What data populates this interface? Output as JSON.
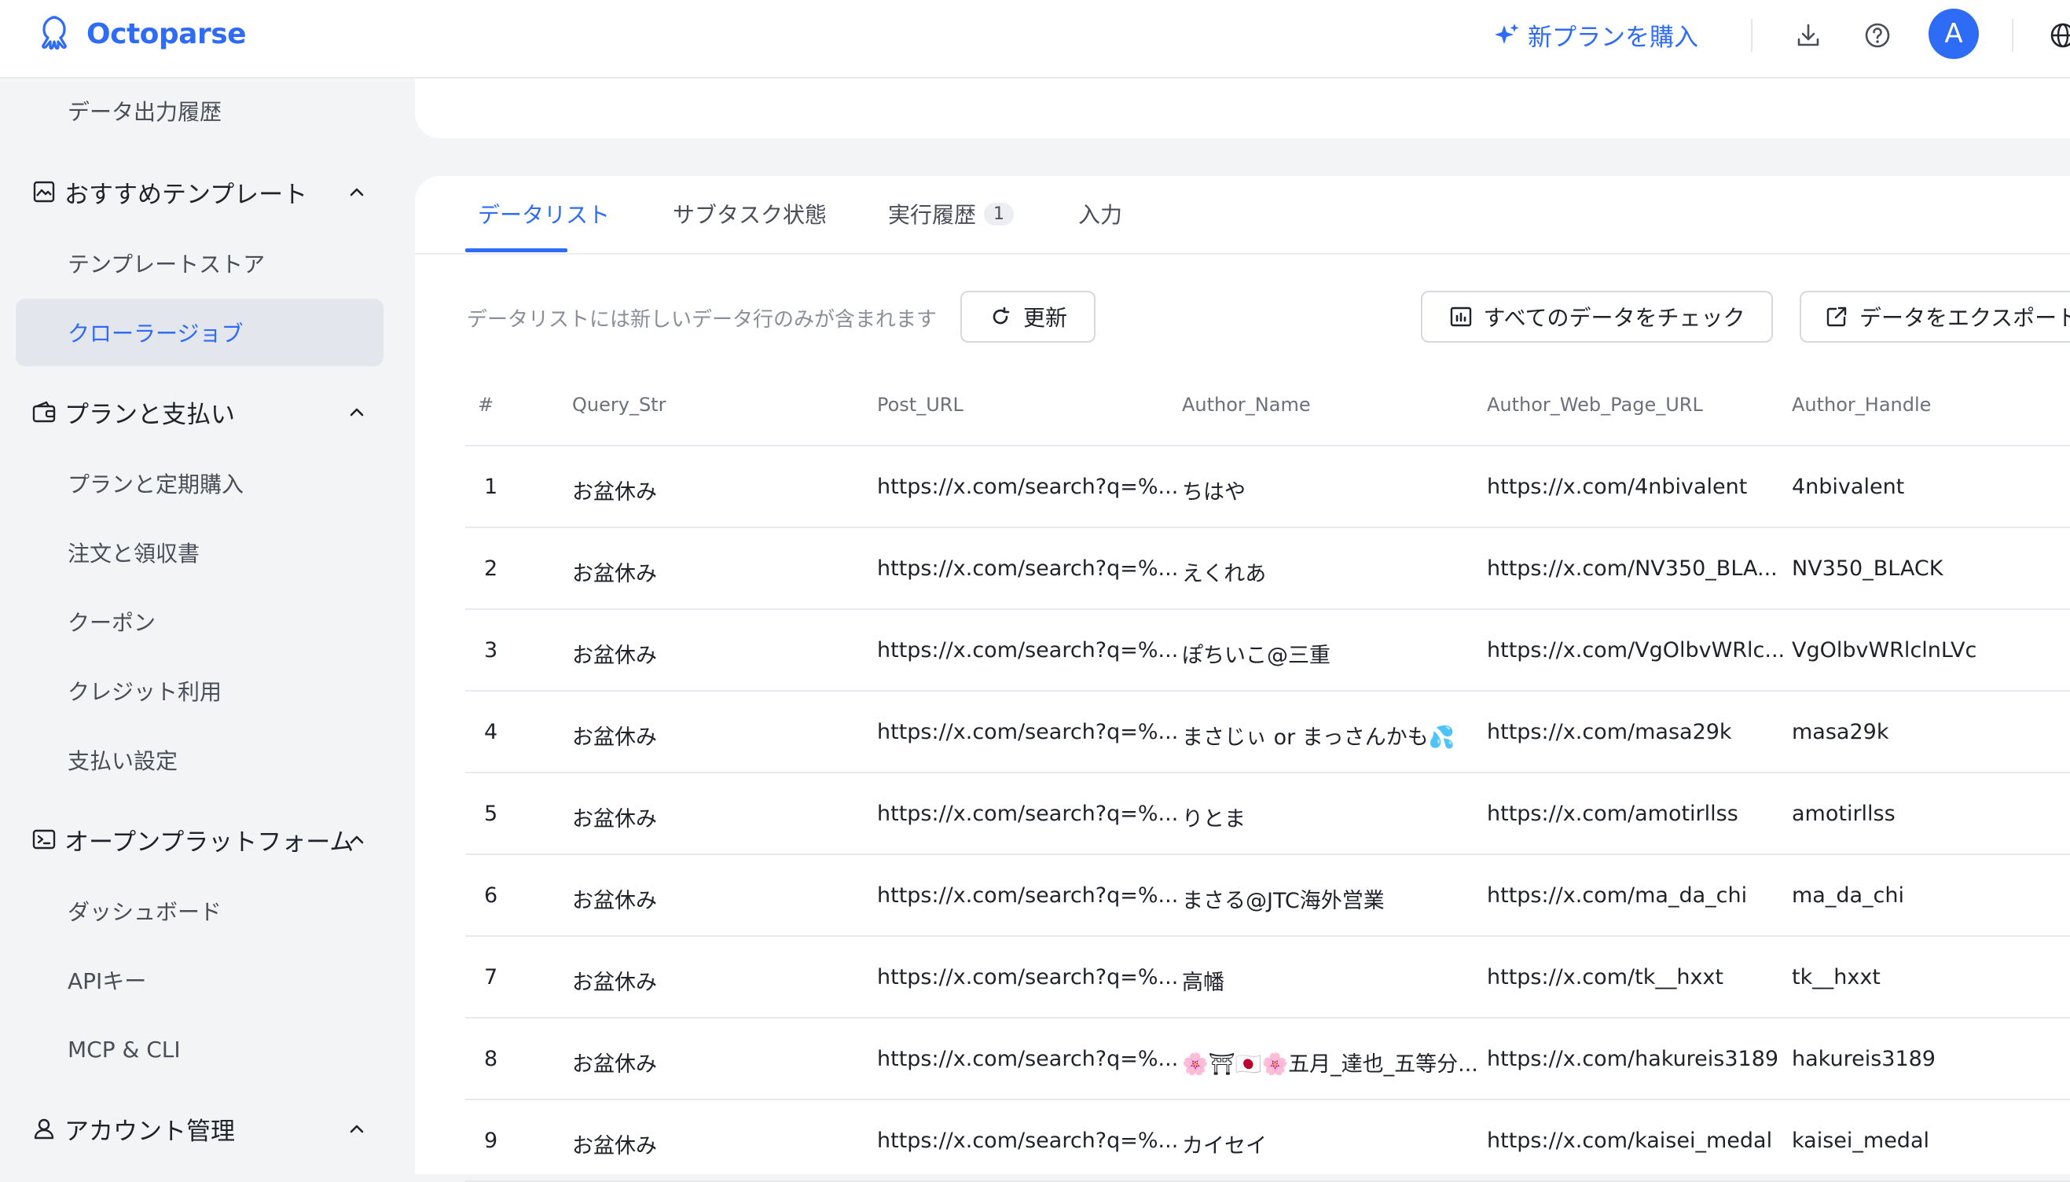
{
  "header": {
    "logo_text": "Octoparse",
    "upgrade_label": "新プランを購入",
    "avatar_initial": "A",
    "icons": [
      "download-icon",
      "help-icon",
      "globe-icon"
    ]
  },
  "sidebar": {
    "top_item": "データ出力履歴",
    "sections": [
      {
        "label": "おすすめテンプレート",
        "icon": "template-icon",
        "items": [
          "テンプレートストア",
          "クローラージョブ"
        ]
      },
      {
        "label": "プランと支払い",
        "icon": "wallet-icon",
        "items": [
          "プランと定期購入",
          "注文と領収書",
          "クーポン",
          "クレジット利用",
          "支払い設定"
        ]
      },
      {
        "label": "オープンプラットフォーム",
        "icon": "terminal-icon",
        "items": [
          "ダッシュボード",
          "APIキー",
          "MCP & CLI"
        ]
      },
      {
        "label": "アカウント管理",
        "icon": "user-icon",
        "items": []
      }
    ],
    "active_item": "クローラージョブ"
  },
  "tabs": [
    {
      "label": "データリスト",
      "active": true
    },
    {
      "label": "サブタスク状態"
    },
    {
      "label": "実行履歴",
      "badge": "1"
    },
    {
      "label": "入力"
    }
  ],
  "toolbar": {
    "hint": "データリストには新しいデータ行のみが含まれます",
    "refresh_label": "更新",
    "check_all_label": "すべてのデータをチェック",
    "export_label": "データをエクスポート"
  },
  "table": {
    "columns": [
      "#",
      "Query_Str",
      "Post_URL",
      "Author_Name",
      "Author_Web_Page_URL",
      "Author_Handle"
    ],
    "rows": [
      [
        "1",
        "お盆休み",
        "https://x.com/search?q=%...",
        "ちはや",
        "https://x.com/4nbivalent",
        "4nbivalent"
      ],
      [
        "2",
        "お盆休み",
        "https://x.com/search?q=%...",
        "えくれあ",
        "https://x.com/NV350_BLA...",
        "NV350_BLACK"
      ],
      [
        "3",
        "お盆休み",
        "https://x.com/search?q=%...",
        "ぽちいこ@三重",
        "https://x.com/VgOlbvWRlc...",
        "VgOlbvWRlclnLVc"
      ],
      [
        "4",
        "お盆休み",
        "https://x.com/search?q=%...",
        "まさじぃ or まっさんかも💦",
        "https://x.com/masa29k",
        "masa29k"
      ],
      [
        "5",
        "お盆休み",
        "https://x.com/search?q=%...",
        "りとま",
        "https://x.com/amotirllss",
        "amotirllss"
      ],
      [
        "6",
        "お盆休み",
        "https://x.com/search?q=%...",
        "まさる@JTC海外営業",
        "https://x.com/ma_da_chi",
        "ma_da_chi"
      ],
      [
        "7",
        "お盆休み",
        "https://x.com/search?q=%...",
        "高幡",
        "https://x.com/tk__hxxt",
        "tk__hxxt"
      ],
      [
        "8",
        "お盆休み",
        "https://x.com/search?q=%...",
        "🌸⛩🇯🇵🌸五月_達也_五等分...",
        "https://x.com/hakureis3189",
        "hakureis3189"
      ],
      [
        "9",
        "お盆休み",
        "https://x.com/search?q=%...",
        "カイセイ",
        "https://x.com/kaisei_medal",
        "kaisei_medal"
      ]
    ]
  },
  "colors": {
    "accent": "#2f6cf6",
    "sidebar_bg": "#f3f4f6",
    "active_item_bg": "#e3e6ec"
  }
}
